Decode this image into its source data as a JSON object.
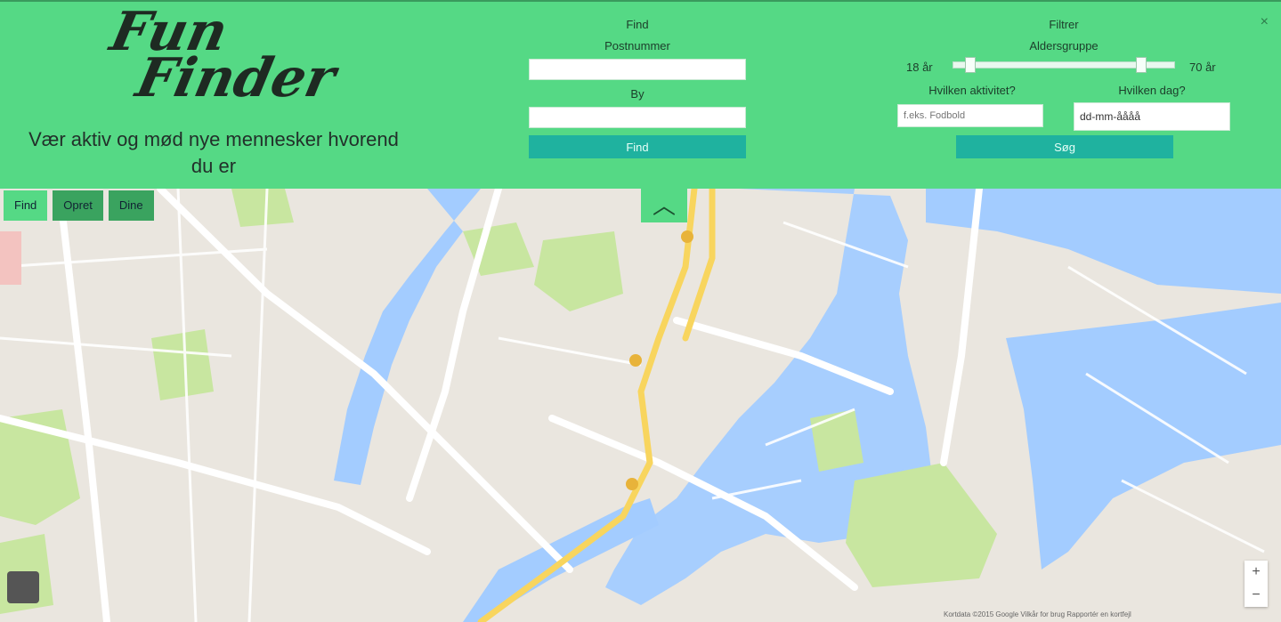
{
  "header": {
    "logo_line1": "Fun",
    "logo_line2": "Finder",
    "tagline": "Vær aktiv og mød nye mennesker hvorend du er",
    "close_symbol": "×"
  },
  "find_form": {
    "heading": "Find",
    "from_label": "Postnummer",
    "to_label": "By",
    "button_label": "Find"
  },
  "filter_form": {
    "heading": "Filtrer",
    "range_label": "Aldersgruppe",
    "range_min": "18 år",
    "range_max": "70 år",
    "range_low_fraction": 0.06,
    "range_high_fraction": 0.86,
    "activity_label": "Hvilken aktivitet?",
    "activity_placeholder": "f.eks. Fodbold",
    "date_label": "Hvilken dag?",
    "date_value": "dd-mm-åååå",
    "button_label": "Søg"
  },
  "tabs": [
    {
      "label": "Find"
    },
    {
      "label": "Opret"
    },
    {
      "label": "Dine"
    }
  ],
  "collapse_icon": "chevron-up-icon",
  "map": {
    "zoom_in": "+",
    "zoom_out": "−",
    "attribution": "Kortdata ©2015 Google  Vilkår for brug  Rapportér en kortfejl"
  },
  "colors": {
    "header_green": "#55d985",
    "button_teal": "#1fb29f",
    "water": "#a3ccff",
    "park": "#c8e6a0",
    "road_major": "#f8d55e"
  }
}
